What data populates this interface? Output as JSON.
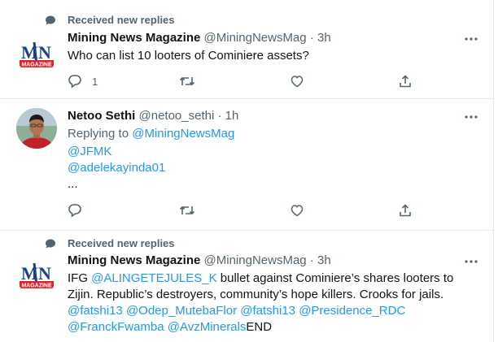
{
  "thread1": {
    "banner": {
      "text": "Received new replies",
      "icon": "reply-bubble-icon"
    },
    "tweet": {
      "name": "Mining News Magazine",
      "handle": "@MiningNewsMag",
      "sep": "·",
      "time": "3h",
      "text": "Who can list 10 looters of Cominiere assets?",
      "reply_count": "1"
    }
  },
  "reply": {
    "name": "Netoo Sethi",
    "handle": "@netoo_sethi",
    "sep": "·",
    "time": "1h",
    "replying_to": "Replying to",
    "mention1": "@MiningNewsMag",
    "mention2": "@JFMK",
    "mention3": "@adelekayinda01",
    "ellipsis": "..."
  },
  "thread2": {
    "banner": {
      "text": "Received new replies",
      "icon": "reply-bubble-icon"
    },
    "tweet": {
      "name": "Mining News Magazine",
      "handle": "@MiningNewsMag",
      "sep": "·",
      "time": "3h",
      "text_prefix": "IFG ",
      "m_alingete": "@ALINGETEJULES_K",
      "text_mid": " bullet against Cominiere’s shares looters to Zijin. Republic’s destroyers, community’s hope killers. Crooks for jails. ",
      "m_fatshi1": "@fatshi13",
      "m_odep": "@Odep_MutebaFlor",
      "m_fatshi2": "@fatshi13",
      "m_presidence": "@Presidence_RDC",
      "m_franck": "@FranckFwamba",
      "m_avz": "@AvzMinerals",
      "text_end": "END"
    }
  },
  "logo": {
    "letters": "MN",
    "word": "MAGAZINE"
  },
  "colors": {
    "link": "#1d9bf0",
    "muted": "#536471",
    "text": "#0f1419",
    "border": "#e6ecf0",
    "logo_red": "#d7262b",
    "logo_blue": "#1c3f8f"
  }
}
